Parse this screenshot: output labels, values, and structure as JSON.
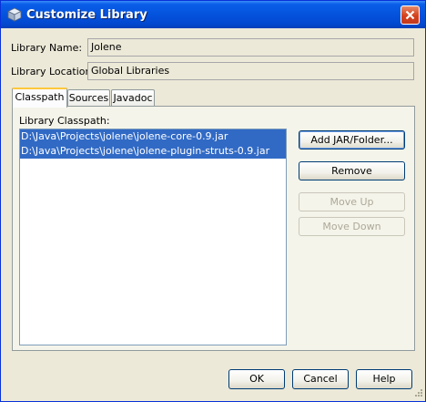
{
  "window": {
    "title": "Customize Library"
  },
  "form": {
    "library_name_label": "Library Name:",
    "library_name_value": "Jolene",
    "library_location_label": "Library Location:",
    "library_location_value": "Global Libraries"
  },
  "tabs": [
    {
      "label": "Classpath",
      "active": true
    },
    {
      "label": "Sources",
      "active": false
    },
    {
      "label": "Javadoc",
      "active": false
    }
  ],
  "classpath": {
    "label": "Library Classpath:",
    "items": [
      "D:\\Java\\Projects\\jolene\\jolene-core-0.9.jar",
      "D:\\Java\\Projects\\jolene\\jolene-plugin-struts-0.9.jar"
    ],
    "buttons": {
      "add": "Add JAR/Folder...",
      "remove": "Remove",
      "move_up": "Move Up",
      "move_down": "Move Down"
    }
  },
  "dialog_buttons": {
    "ok": "OK",
    "cancel": "Cancel",
    "help": "Help"
  },
  "icons": {
    "title": "library-cube-icon",
    "close": "close-icon",
    "grip": "resize-grip-icon"
  },
  "colors": {
    "titlebar": "#0453dd",
    "selection": "#316ac5",
    "tab_highlight": "#ffc83c",
    "dialog_bg": "#ece9d8"
  }
}
